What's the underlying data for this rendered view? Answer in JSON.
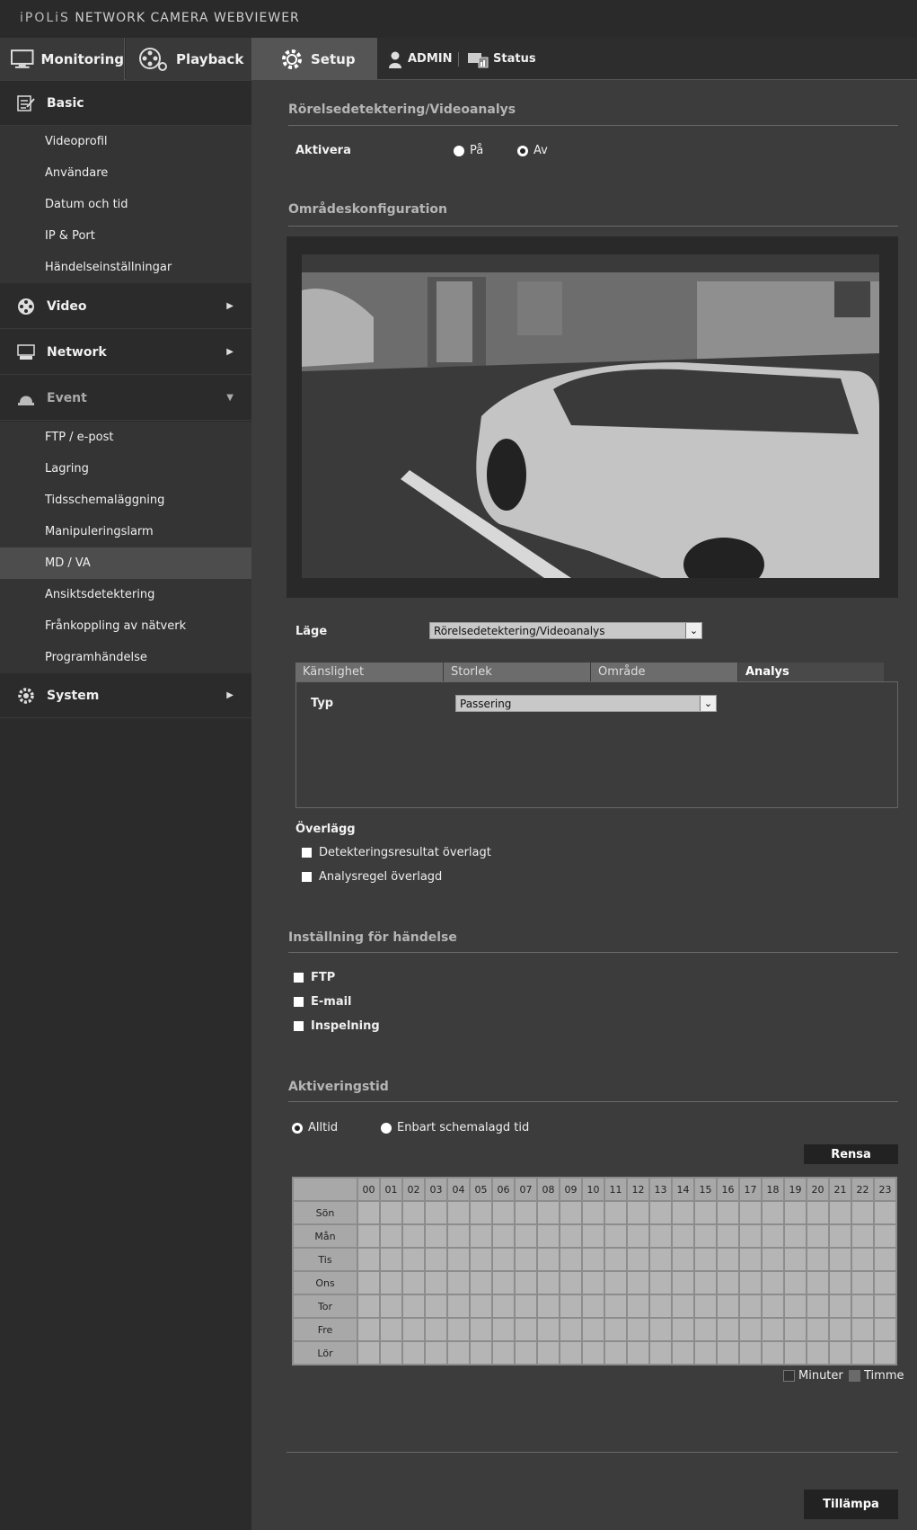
{
  "app": {
    "brand_prefix": "iPOLiS",
    "brand_rest": " NETWORK CAMERA WEBVIEWER"
  },
  "nav": {
    "monitoring": "Monitoring",
    "playback": "Playback",
    "setup": "Setup",
    "admin": "ADMIN",
    "status": "Status"
  },
  "sidebar": {
    "basic": "Basic",
    "basic_items": [
      "Videoprofil",
      "Användare",
      "Datum och tid",
      "IP & Port",
      "Händelseinställningar"
    ],
    "video": "Video",
    "network": "Network",
    "event": "Event",
    "event_items": [
      "FTP / e-post",
      "Lagring",
      "Tidsschemaläggning",
      "Manipuleringslarm",
      "MD / VA",
      "Ansiktsdetektering",
      "Frånkoppling av nätverk",
      "Programhändelse"
    ],
    "system": "System"
  },
  "md": {
    "title": "Rörelsedetektering/Videoanalys",
    "enable_label": "Aktivera",
    "on": "På",
    "off": "Av"
  },
  "area": {
    "title": "Områdeskonfiguration",
    "mode_label": "Läge",
    "mode_value": "Rörelsedetektering/Videoanalys",
    "tabs": [
      "Känslighet",
      "Storlek",
      "Område",
      "Analys"
    ],
    "type_label": "Typ",
    "type_value": "Passering",
    "overlay_title": "Överlägg",
    "overlay_items": [
      "Detekteringsresultat överlagt",
      "Analysregel överlagd"
    ]
  },
  "event": {
    "title": "Inställning för händelse",
    "items": [
      "FTP",
      "E-mail",
      "Inspelning"
    ]
  },
  "activation": {
    "title": "Aktiveringstid",
    "always": "Alltid",
    "scheduled": "Enbart schemalagd tid",
    "clear": "Rensa",
    "hours": [
      "00",
      "01",
      "02",
      "03",
      "04",
      "05",
      "06",
      "07",
      "08",
      "09",
      "10",
      "11",
      "12",
      "13",
      "14",
      "15",
      "16",
      "17",
      "18",
      "19",
      "20",
      "21",
      "22",
      "23"
    ],
    "days": [
      "Sön",
      "Mån",
      "Tis",
      "Ons",
      "Tor",
      "Fre",
      "Lör"
    ],
    "legend_minutes": "Minuter",
    "legend_hour": "Timme"
  },
  "apply": "Tillämpa"
}
